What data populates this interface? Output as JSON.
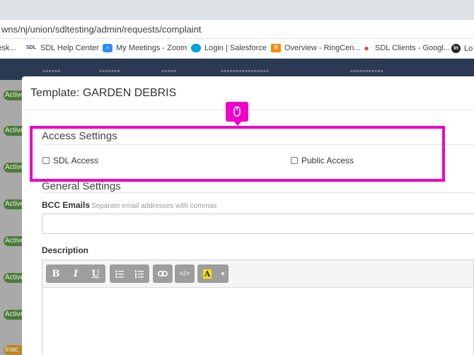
{
  "browser": {
    "url": "wns/nj/union/sdltesting/admin/requests/complaint",
    "bookmarks": [
      {
        "label": "lesk...",
        "icon": "bookmark-icon"
      },
      {
        "label": "SDL Help Center",
        "icon": "sdl-icon"
      },
      {
        "label": "My Meetings - Zoom",
        "icon": "zoom-icon"
      },
      {
        "label": "Login | Salesforce",
        "icon": "salesforce-icon"
      },
      {
        "label": "Overview - RingCen...",
        "icon": "ringcentral-icon"
      },
      {
        "label": "SDL Clients - Googl...",
        "icon": "map-pin-icon"
      },
      {
        "label": "Lo",
        "icon": "linkedin-icon"
      }
    ]
  },
  "app": {
    "side_badges": [
      "Active",
      "Active",
      "Active",
      "Active",
      "Active",
      "Active",
      "Active",
      "Inac"
    ]
  },
  "modal": {
    "title": "Template: GARDEN DEBRIS",
    "access": {
      "legend": "Access Settings",
      "sdl_label": "SDL Access",
      "public_label": "Public Access"
    },
    "general": {
      "legend": "General Settings",
      "bcc_label": "BCC Emails",
      "bcc_help": "Separate email addresses with commas",
      "bcc_value": ""
    },
    "description": {
      "label": "Description",
      "toolbar": {
        "bold": "B",
        "italic": "I",
        "underline": "U",
        "code": "</>",
        "highlight": "A"
      }
    }
  },
  "annotation": {
    "color": "#ee00c8",
    "icon": "mouse-icon"
  }
}
